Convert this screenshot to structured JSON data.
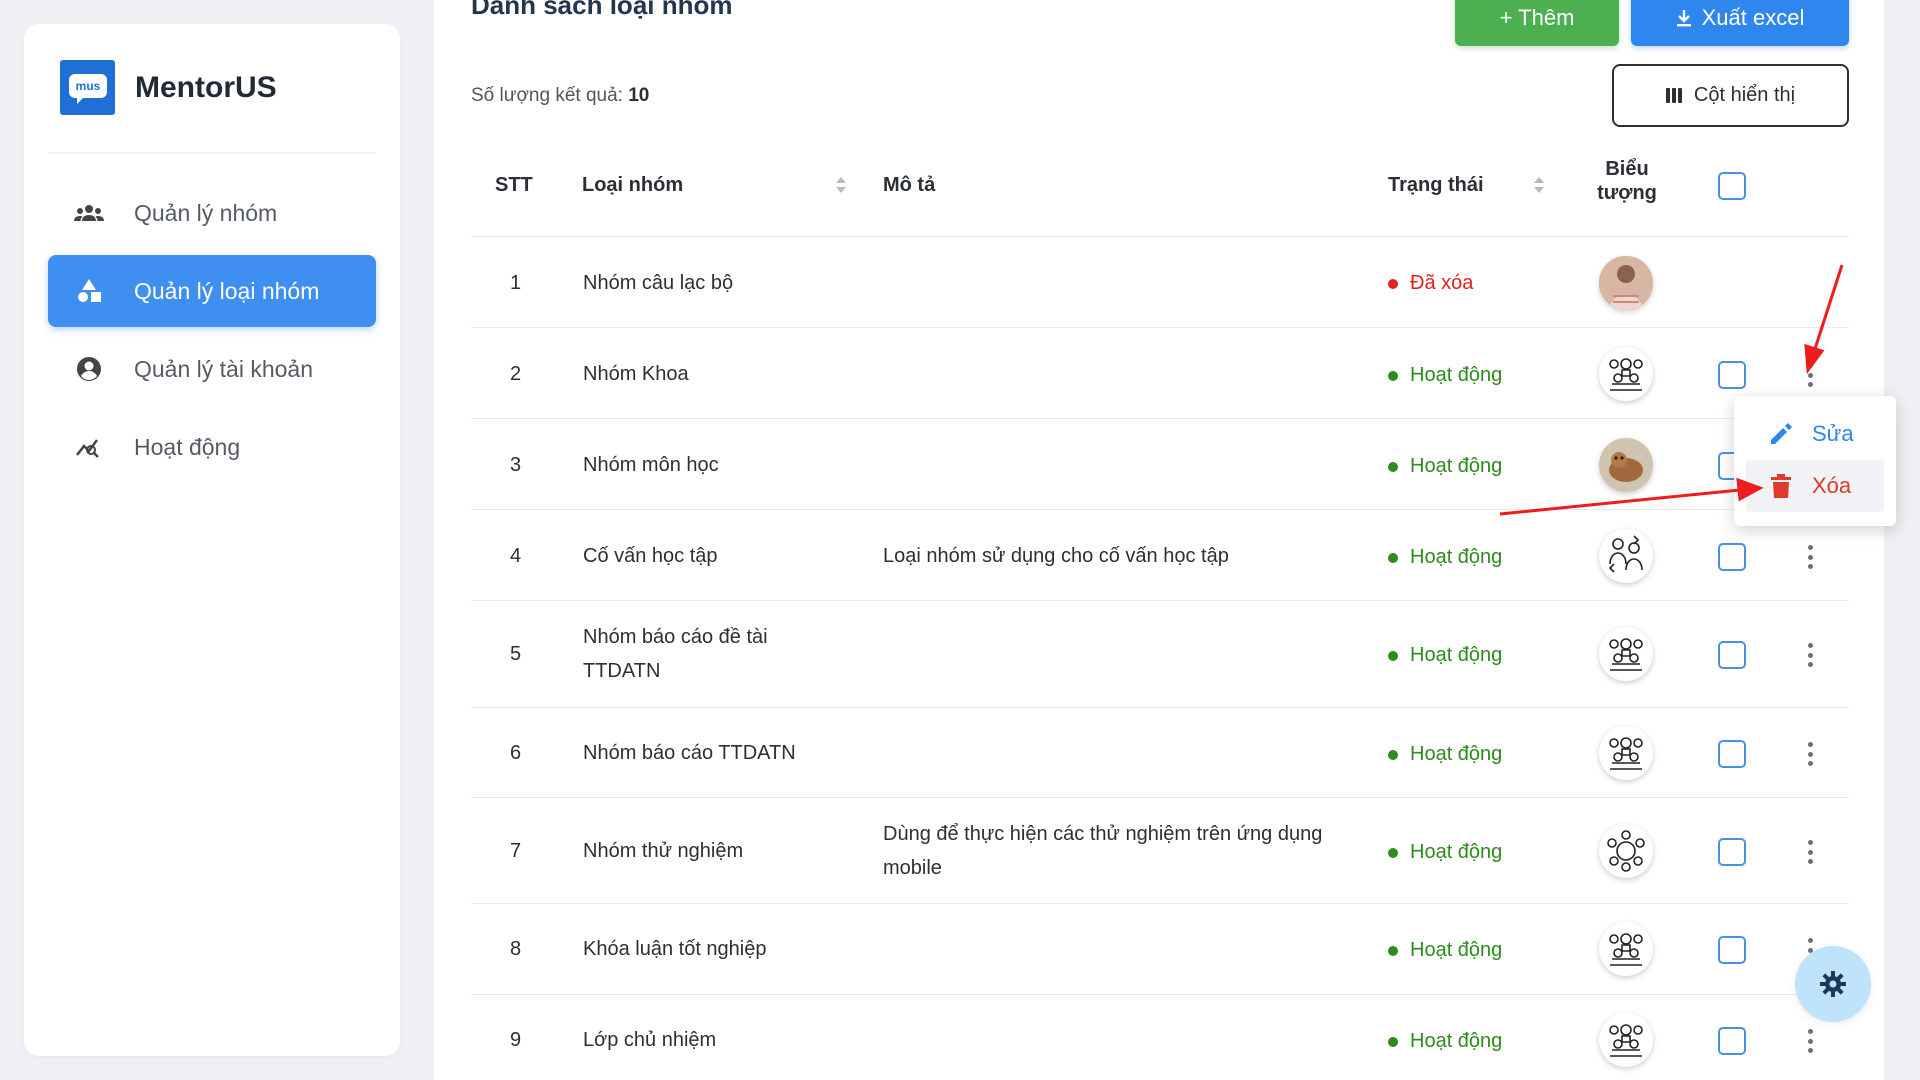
{
  "app": {
    "brand_name": "MentorUS",
    "logo_text": "mus"
  },
  "sidebar": {
    "items": [
      {
        "label": "Quản lý nhóm",
        "icon": "groups-icon"
      },
      {
        "label": "Quản lý loại nhóm",
        "icon": "category-icon",
        "active": true
      },
      {
        "label": "Quản lý tài khoản",
        "icon": "account-circle-icon"
      },
      {
        "label": "Hoạt động",
        "icon": "activity-chart-icon"
      }
    ]
  },
  "header": {
    "title": "Danh sách loại nhóm",
    "add_label": "+ Thêm",
    "export_label": "Xuất excel",
    "columns_label": "Cột hiển thị",
    "result_prefix": "Số lượng kết quả:",
    "result_count": "10"
  },
  "table": {
    "headers": {
      "stt": "STT",
      "type": "Loại nhóm",
      "description": "Mô tả",
      "status": "Trạng thái",
      "icon_line1": "Biểu",
      "icon_line2": "tượng"
    },
    "rows": [
      {
        "stt": "1",
        "type": "Nhóm câu lạc bộ",
        "description": "",
        "status": "Đã xóa",
        "status_color": "#e0221a",
        "icon": "photo-avatar-icon"
      },
      {
        "stt": "2",
        "type": "Nhóm Khoa",
        "description": "",
        "status": "Hoạt động",
        "status_color": "#2e8b1e",
        "icon": "group-people-icon"
      },
      {
        "stt": "3",
        "type": "Nhóm môn học",
        "description": "",
        "status": "Hoạt động",
        "status_color": "#2e8b1e",
        "icon": "photo-avatar-icon"
      },
      {
        "stt": "4",
        "type": "Cố vấn học tập",
        "description": "Loại nhóm sử dụng cho cố vấn học tập",
        "status": "Hoạt động",
        "status_color": "#2e8b1e",
        "icon": "mentor-people-icon"
      },
      {
        "stt": "5",
        "type": "Nhóm báo cáo đề tài TTDATN",
        "description": "",
        "status": "Hoạt động",
        "status_color": "#2e8b1e",
        "icon": "group-people-icon"
      },
      {
        "stt": "6",
        "type": "Nhóm báo cáo TTDATN",
        "description": "",
        "status": "Hoạt động",
        "status_color": "#2e8b1e",
        "icon": "group-people-icon"
      },
      {
        "stt": "7",
        "type": "Nhóm thử nghiệm",
        "description": "Dùng để thực hiện các thử nghiệm trên ứng dụng mobile",
        "status": "Hoạt động",
        "status_color": "#2e8b1e",
        "icon": "team-circle-icon"
      },
      {
        "stt": "8",
        "type": "Khóa luận tốt nghiệp",
        "description": "",
        "status": "Hoạt động",
        "status_color": "#2e8b1e",
        "icon": "group-people-icon"
      },
      {
        "stt": "9",
        "type": "Lớp chủ nhiệm",
        "description": "",
        "status": "Hoạt động",
        "status_color": "#2e8b1e",
        "icon": "group-people-icon"
      }
    ]
  },
  "row_menu": {
    "edit_label": "Sửa",
    "delete_label": "Xóa"
  },
  "colors": {
    "primary": "#2f86ef",
    "success": "#4caf50",
    "danger": "#e03a2b",
    "annotation_arrow": "#ee1c1c"
  }
}
